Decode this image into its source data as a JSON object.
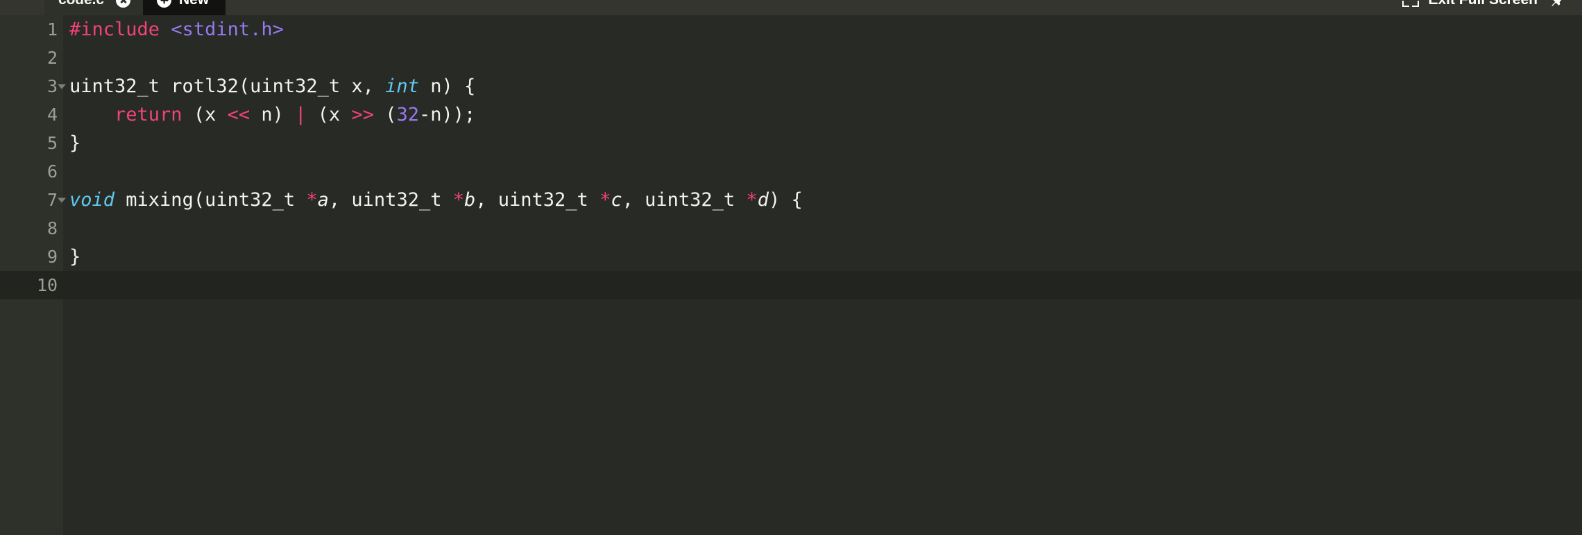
{
  "window": {
    "background": "#282a25"
  },
  "topbar": {
    "background": "#33352e",
    "tab": {
      "title": "code.c*",
      "close_icon": "close-icon"
    },
    "new_tab": {
      "label": "New",
      "icon": "plus-circle-icon"
    },
    "exit_fullscreen": {
      "label": "Exit Full Screen",
      "icon": "fullscreen-exit-icon"
    },
    "pin": {
      "icon": "pin-icon"
    }
  },
  "editor": {
    "gutter_background": "#2e302a",
    "background": "#282a25",
    "active_line_background": "#222420",
    "active_line": 10,
    "language": "c",
    "line_count": 10,
    "lines": [
      {
        "number": "1",
        "foldable": false,
        "tokens": [
          {
            "text": "#include",
            "type": "pre"
          },
          {
            "text": " ",
            "type": "plain"
          },
          {
            "text": "<stdint.h>",
            "type": "inc"
          }
        ]
      },
      {
        "number": "2",
        "foldable": false,
        "tokens": []
      },
      {
        "number": "3",
        "foldable": true,
        "tokens": [
          {
            "text": "uint32_t rotl32(uint32_t x, ",
            "type": "plain"
          },
          {
            "text": "int",
            "type": "type"
          },
          {
            "text": " n) {",
            "type": "plain"
          }
        ]
      },
      {
        "number": "4",
        "foldable": false,
        "tokens": [
          {
            "text": "    ",
            "type": "plain"
          },
          {
            "text": "return",
            "type": "kw"
          },
          {
            "text": " (x ",
            "type": "plain"
          },
          {
            "text": "<<",
            "type": "op"
          },
          {
            "text": " n) ",
            "type": "plain"
          },
          {
            "text": "|",
            "type": "op"
          },
          {
            "text": " (x ",
            "type": "plain"
          },
          {
            "text": ">>",
            "type": "op"
          },
          {
            "text": " (",
            "type": "plain"
          },
          {
            "text": "32",
            "type": "num"
          },
          {
            "text": "-n));",
            "type": "plain"
          }
        ]
      },
      {
        "number": "5",
        "foldable": false,
        "tokens": [
          {
            "text": "}",
            "type": "plain"
          }
        ]
      },
      {
        "number": "6",
        "foldable": false,
        "tokens": []
      },
      {
        "number": "7",
        "foldable": true,
        "tokens": [
          {
            "text": "void",
            "type": "type"
          },
          {
            "text": " mixing(uint32_t ",
            "type": "plain"
          },
          {
            "text": "*",
            "type": "op"
          },
          {
            "text": "a",
            "type": "var"
          },
          {
            "text": ", uint32_t ",
            "type": "plain"
          },
          {
            "text": "*",
            "type": "op"
          },
          {
            "text": "b",
            "type": "var"
          },
          {
            "text": ", uint32_t ",
            "type": "plain"
          },
          {
            "text": "*",
            "type": "op"
          },
          {
            "text": "c",
            "type": "var"
          },
          {
            "text": ", uint32_t ",
            "type": "plain"
          },
          {
            "text": "*",
            "type": "op"
          },
          {
            "text": "d",
            "type": "var"
          },
          {
            "text": ") {",
            "type": "plain"
          }
        ]
      },
      {
        "number": "8",
        "foldable": false,
        "tokens": []
      },
      {
        "number": "9",
        "foldable": false,
        "tokens": [
          {
            "text": "}",
            "type": "plain"
          }
        ]
      },
      {
        "number": "10",
        "foldable": false,
        "tokens": []
      }
    ]
  },
  "syntax_colors": {
    "preprocessor": "#f0437d",
    "include_path": "#9879f0",
    "keyword": "#f0437d",
    "type": "#5fc9f0",
    "number": "#9879f0",
    "operator": "#f0437d",
    "plain": "#f2f2ef",
    "line_number": "#9d9f96"
  }
}
